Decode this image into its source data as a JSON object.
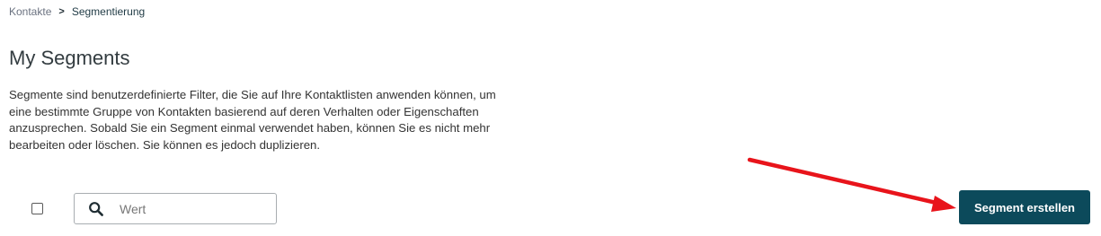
{
  "breadcrumb": {
    "items": [
      "Kontakte",
      "Segmentierung"
    ],
    "separator": ">"
  },
  "page": {
    "title": "My Segments",
    "description": "Segmente sind benutzerdefinierte Filter, die Sie auf Ihre Kontaktlisten anwenden können, um eine bestimmte Gruppe von Kontakten basierend auf deren Verhalten oder Eigenschaften anzusprechen. Sobald Sie ein Segment einmal verwendet haben, können Sie es nicht mehr bearbeiten oder löschen. Sie können es jedoch duplizieren."
  },
  "toolbar": {
    "search_placeholder": "Wert",
    "search_value": "",
    "search_icon": "search-icon",
    "create_label": "Segment erstellen",
    "select_all_checked": false
  },
  "colors": {
    "primary_button": "#0c4a5b",
    "annotation_arrow": "#e8141b"
  }
}
